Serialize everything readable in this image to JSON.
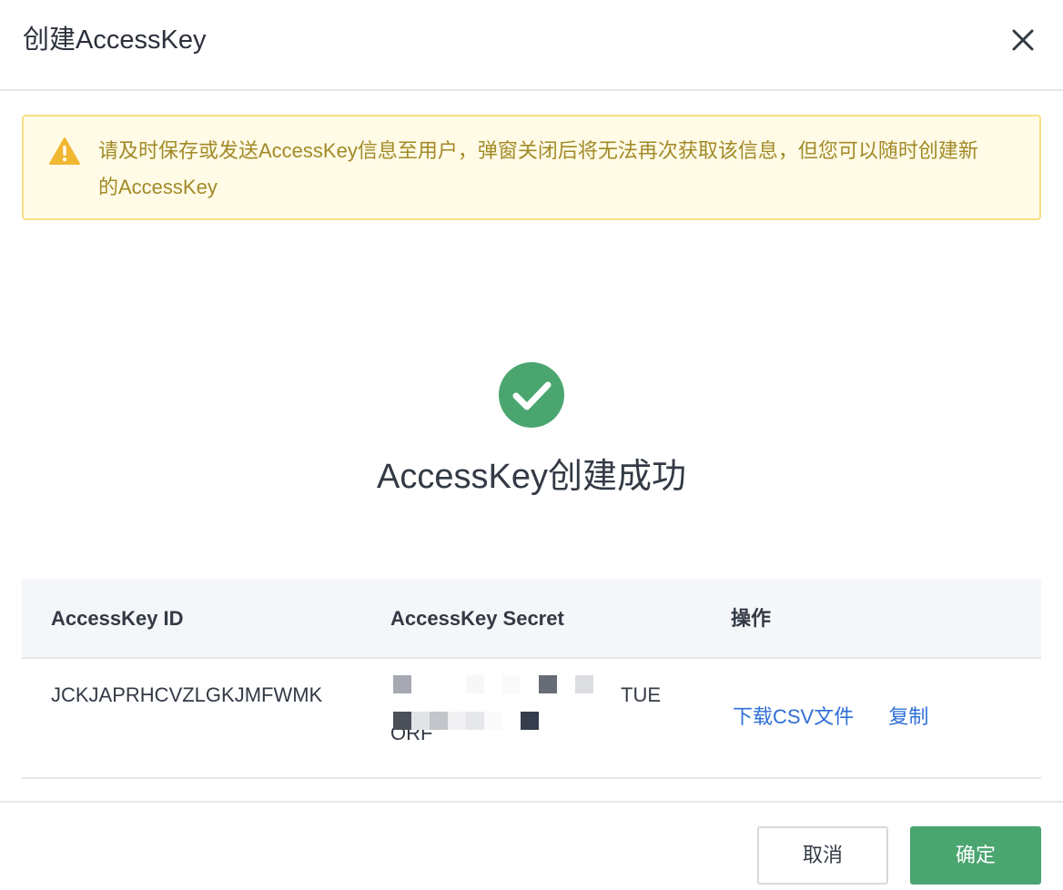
{
  "dialog": {
    "title": "创建AccessKey",
    "close_icon": "close-icon"
  },
  "alert": {
    "icon": "warning-icon",
    "text": "请及时保存或发送AccessKey信息至用户，弹窗关闭后将无法再次获取该信息，但您可以随时创建新的AccessKey",
    "color": "#a28a28",
    "background": "#fffbe6",
    "border": "#f7df87"
  },
  "result": {
    "icon": "check-circle-icon",
    "text": "AccessKey创建成功",
    "icon_color": "#4aa56f"
  },
  "table": {
    "headers": [
      "AccessKey ID",
      "AccessKey Secret",
      "操作"
    ],
    "rows": [
      {
        "access_key_id": "JCKJAPRHCVZLGKJMFWMK",
        "access_key_secret_visible_line1": "TUE",
        "access_key_secret_visible_line2": "ORF",
        "secret_obscured": true,
        "actions": [
          "下载CSV文件",
          "复制"
        ]
      }
    ]
  },
  "footer": {
    "cancel_label": "取消",
    "ok_label": "确定"
  },
  "colors": {
    "primary": "#4aa56f",
    "link": "#2f6fd6"
  }
}
